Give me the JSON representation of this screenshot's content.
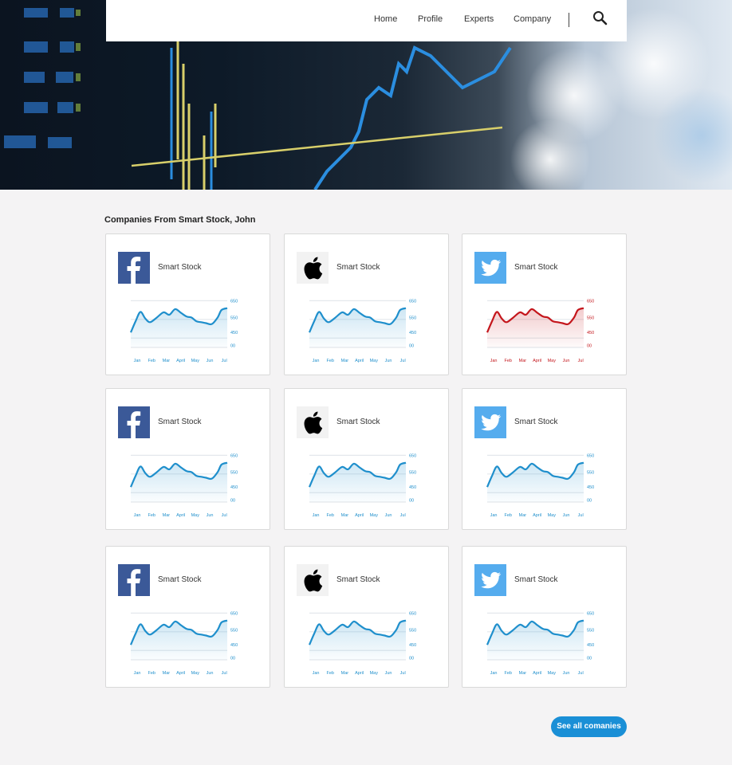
{
  "nav": {
    "items": [
      {
        "label": "Home"
      },
      {
        "label": "Profile"
      },
      {
        "label": "Experts"
      },
      {
        "label": "Company"
      }
    ]
  },
  "section_title": "Companies From Smart Stock, John",
  "colors": {
    "accent_blue": "#1a8fd6",
    "chart_blue": "#1f8fcc",
    "chart_red": "#c4161c",
    "facebook": "#3b5998",
    "twitter": "#55acee"
  },
  "chart": {
    "months": [
      "Jan",
      "Feb",
      "Mar",
      "April",
      "May",
      "Jun",
      "Jul"
    ],
    "y_ticks": [
      "650",
      "550",
      "450",
      "00"
    ],
    "line": [
      [
        0.0,
        480
      ],
      [
        0.05,
        540
      ],
      [
        0.1,
        590
      ],
      [
        0.15,
        555
      ],
      [
        0.2,
        535
      ],
      [
        0.27,
        560
      ],
      [
        0.34,
        588
      ],
      [
        0.4,
        575
      ],
      [
        0.46,
        605
      ],
      [
        0.52,
        585
      ],
      [
        0.58,
        565
      ],
      [
        0.63,
        560
      ],
      [
        0.68,
        540
      ],
      [
        0.73,
        535
      ],
      [
        0.78,
        530
      ],
      [
        0.84,
        525
      ],
      [
        0.9,
        560
      ],
      [
        0.94,
        600
      ],
      [
        1.0,
        610
      ]
    ]
  },
  "cards": [
    {
      "company": "facebook",
      "logo_icon": "facebook-logo-icon",
      "name": "Smart Stock",
      "trend": "up"
    },
    {
      "company": "apple",
      "logo_icon": "apple-logo-icon",
      "name": "Smart Stock",
      "trend": "up"
    },
    {
      "company": "twitter",
      "logo_icon": "twitter-logo-icon",
      "name": "Smart Stock",
      "trend": "down"
    },
    {
      "company": "facebook",
      "logo_icon": "facebook-logo-icon",
      "name": "Smart Stock",
      "trend": "up"
    },
    {
      "company": "apple",
      "logo_icon": "apple-logo-icon",
      "name": "Smart Stock",
      "trend": "up"
    },
    {
      "company": "twitter",
      "logo_icon": "twitter-logo-icon",
      "name": "Smart Stock",
      "trend": "up"
    },
    {
      "company": "facebook",
      "logo_icon": "facebook-logo-icon",
      "name": "Smart Stock",
      "trend": "up"
    },
    {
      "company": "apple",
      "logo_icon": "apple-logo-icon",
      "name": "Smart Stock",
      "trend": "up"
    },
    {
      "company": "twitter",
      "logo_icon": "twitter-logo-icon",
      "name": "Smart Stock",
      "trend": "up"
    }
  ],
  "see_all_label": "See all comanies"
}
